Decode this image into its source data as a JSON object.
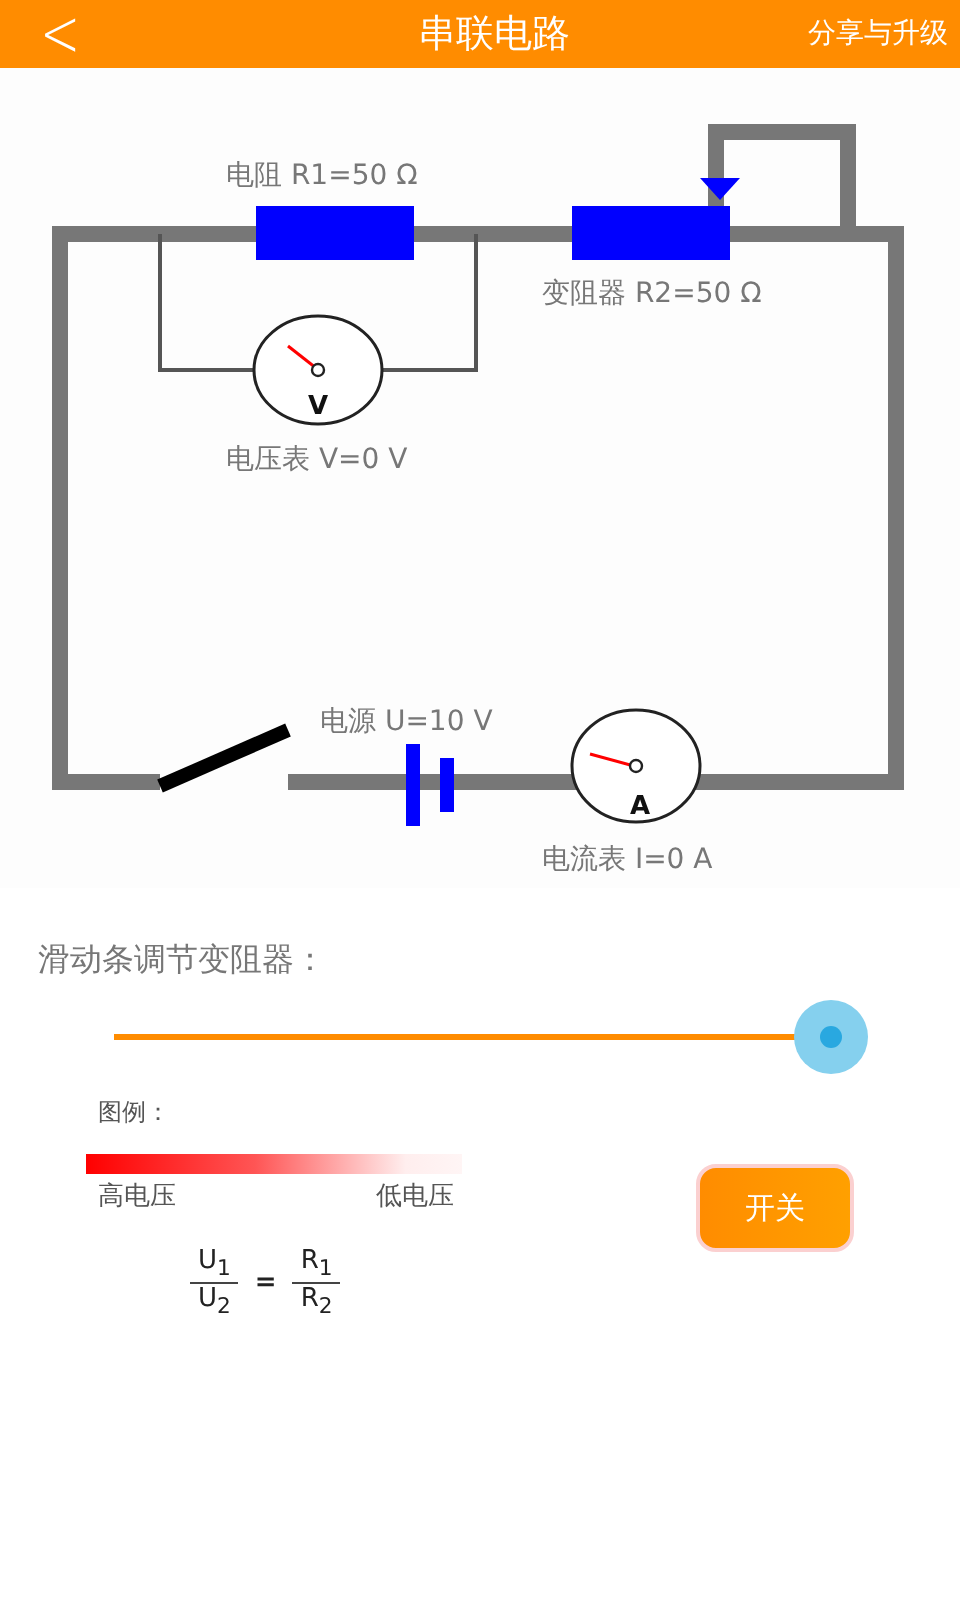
{
  "header": {
    "back_glyph": "<",
    "title": "串联电路",
    "action": "分享与升级"
  },
  "circuit": {
    "resistor_label": "电阻 R1=50 Ω",
    "rheostat_label": "变阻器 R2=50 Ω",
    "voltmeter_label": "电压表 V=0 V",
    "voltmeter_letter": "V",
    "source_label": "电源 U=10 V",
    "ammeter_label": "电流表 I=0 A",
    "ammeter_letter": "A",
    "switch_closed": false
  },
  "slider": {
    "label": "滑动条调节变阻器：",
    "level": 1.0
  },
  "legend": {
    "title": "图例：",
    "high": "高电压",
    "low": "低电压"
  },
  "formula": {
    "left_top": "U$_{1}$",
    "left_bottom": "U$_{2}$",
    "equals": "=",
    "right_top": "R$_{1}$",
    "right_bottom": "R$_{2}$"
  },
  "switch_button": "开关"
}
